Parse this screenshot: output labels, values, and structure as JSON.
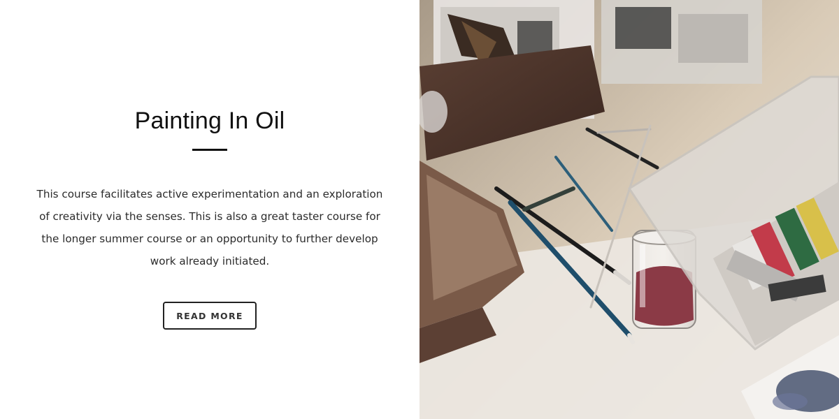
{
  "course": {
    "title": "Painting In Oil",
    "description": "This course facilitates active experimentation and an exploration of creativity via the senses. This is also a great taster course for the longer summer course or an opportunity to further develop work already initiated.",
    "button_label": "READ MORE"
  },
  "image": {
    "subject": "oil painting supplies on a table: brushes, paint tubes, trays and a glass of water"
  }
}
